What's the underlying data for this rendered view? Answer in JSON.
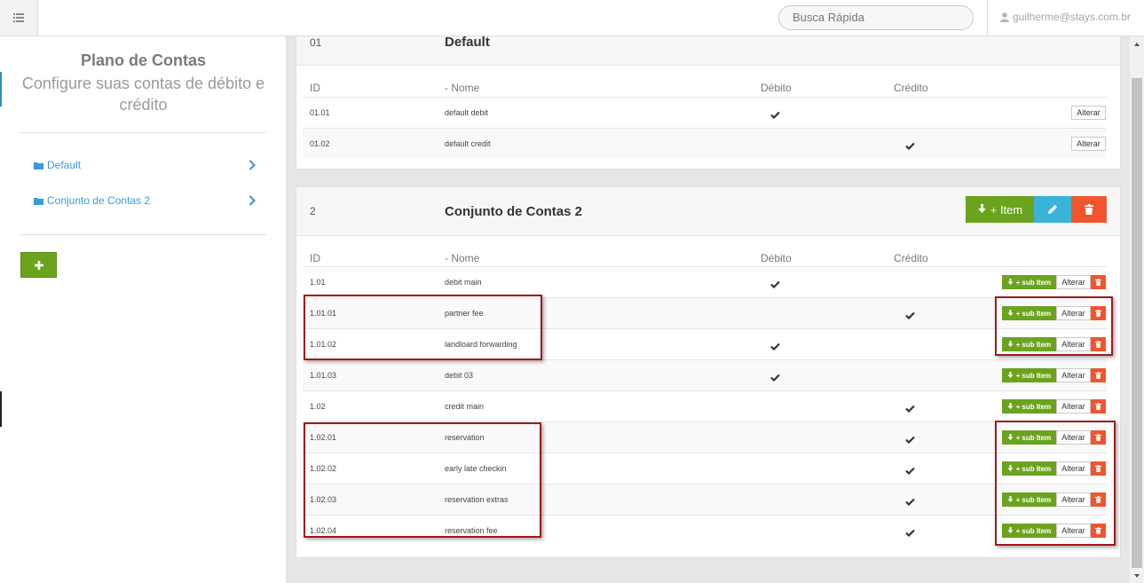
{
  "topbar": {
    "search_placeholder": "Busca Rápida",
    "user_email": "guilherme@stays.com.br"
  },
  "sidebar": {
    "title": "Plano de Contas",
    "subtitle": "Configure suas contas de débito e crédito",
    "groups": [
      {
        "label": "Default"
      },
      {
        "label": "Conjunto de Contas 2"
      }
    ]
  },
  "columns": {
    "id": "ID",
    "name": "- Nome",
    "debit": "Débito",
    "credit": "Crédito"
  },
  "group1": {
    "id": "01",
    "name": "Default",
    "rows": [
      {
        "id": "01.01",
        "name": "default debit",
        "debit": true,
        "credit": false
      },
      {
        "id": "01.02",
        "name": "default credit",
        "debit": false,
        "credit": true
      }
    ]
  },
  "group2": {
    "id": "2",
    "name": "Conjunto de Contas 2",
    "rows": [
      {
        "id": "1.01",
        "name": "debit main",
        "debit": true,
        "credit": false
      },
      {
        "id": "1.01.01",
        "name": "partner fee",
        "debit": false,
        "credit": true
      },
      {
        "id": "1.01.02",
        "name": "landloard forwarding",
        "debit": true,
        "credit": false
      },
      {
        "id": "1.01.03",
        "name": "debit 03",
        "debit": true,
        "credit": false
      },
      {
        "id": "1.02",
        "name": "credit main",
        "debit": false,
        "credit": true
      },
      {
        "id": "1.02.01",
        "name": "reservation",
        "debit": false,
        "credit": true
      },
      {
        "id": "1.02.02",
        "name": "early late checkin",
        "debit": false,
        "credit": true
      },
      {
        "id": "1.02.03",
        "name": "reservation extras",
        "debit": false,
        "credit": true
      },
      {
        "id": "1.02.04",
        "name": "reservation fee",
        "debit": false,
        "credit": true
      }
    ]
  },
  "labels": {
    "alterar": "Alterar",
    "sub_item": "sub Item",
    "item": "Item"
  },
  "colors": {
    "green": "#6ba31e",
    "blue": "#39b3d7",
    "red": "#f0552f",
    "link": "#3a9ad9",
    "highlight": "#a01a1a"
  }
}
